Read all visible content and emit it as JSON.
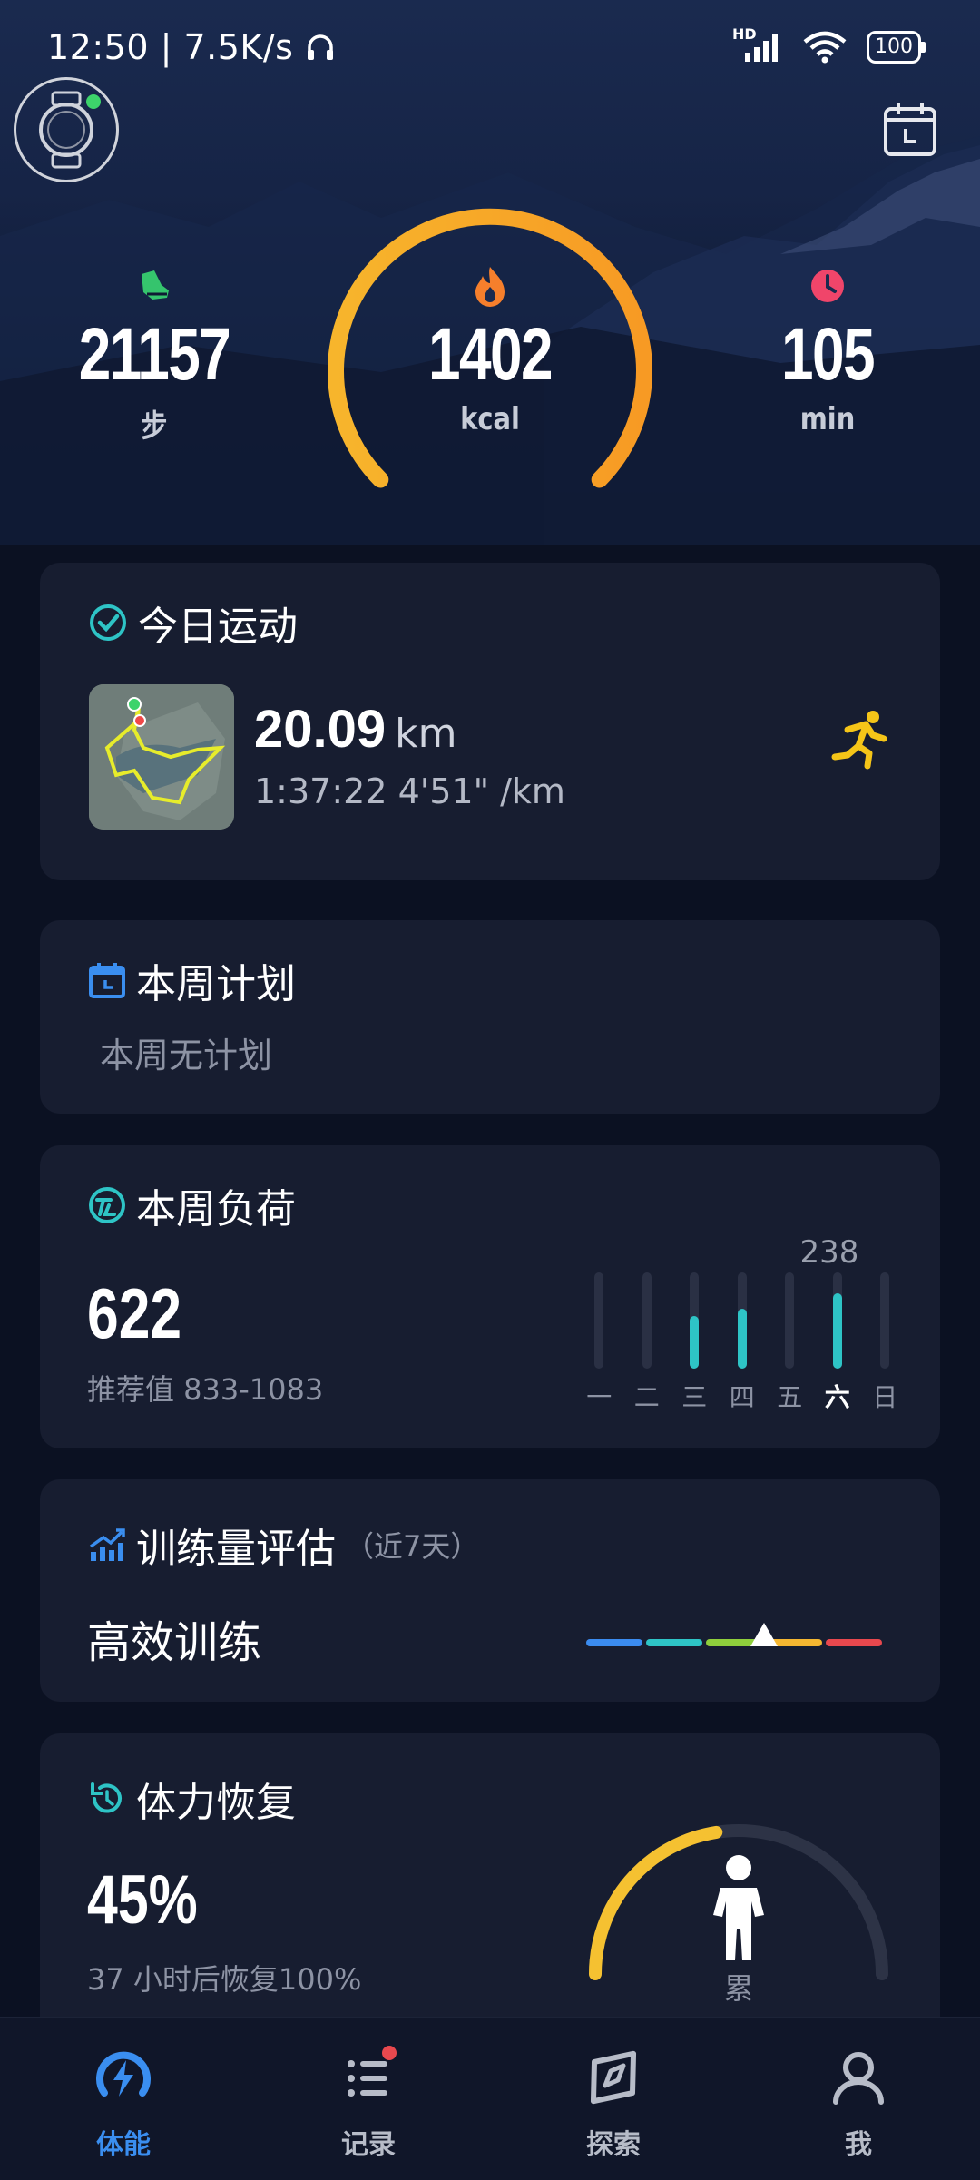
{
  "status_bar": {
    "time": "12:50",
    "speed": "7.5K/s",
    "battery": "100",
    "network": "HD"
  },
  "header": {
    "watch_icon": "watch-icon",
    "calendar_icon": "calendar-icon"
  },
  "summary": {
    "steps": {
      "value": "21157",
      "unit": "步",
      "icon": "footprint-icon"
    },
    "calories": {
      "value": "1402",
      "unit": "kcal",
      "icon": "flame-icon"
    },
    "minutes": {
      "value": "105",
      "unit": "min",
      "icon": "clock-icon"
    }
  },
  "today_workout": {
    "title": "今日运动",
    "distance": "20.09",
    "distance_unit": "km",
    "duration": "1:37:22",
    "pace": "4'51\" /km",
    "activity_icon": "running-icon"
  },
  "weekly_plan": {
    "title": "本周计划",
    "text": "本周无计划"
  },
  "weekly_load": {
    "title": "本周负荷",
    "value": "622",
    "recommend": "推荐值 833-1083",
    "peak_label": "238",
    "days": [
      "一",
      "二",
      "三",
      "四",
      "五",
      "六",
      "日"
    ],
    "levels": [
      0,
      0,
      0.7,
      0.8,
      0,
      1.0,
      0
    ],
    "active_day_index": 5
  },
  "training_eval": {
    "title": "训练量评估",
    "subtitle": "（近7天）",
    "status": "高效训练",
    "scale_colors": [
      "#3b8cf0",
      "#2ec4c6",
      "#8fcf3c",
      "#f5b731",
      "#e8484e"
    ],
    "marker_position": 0.6
  },
  "recovery": {
    "title": "体力恢复",
    "percent": "45%",
    "note": "37 小时后恢复100%",
    "state": "累",
    "level": 0.45
  },
  "tabs": [
    {
      "label": "体能",
      "icon": "energy-icon",
      "active": true
    },
    {
      "label": "记录",
      "icon": "list-icon",
      "active": false,
      "badge": true
    },
    {
      "label": "探索",
      "icon": "compass-icon",
      "active": false
    },
    {
      "label": "我",
      "icon": "profile-icon",
      "active": false
    }
  ],
  "colors": {
    "accent": "#3a8ef0",
    "ring": "#f7a928",
    "load_bar": "#2ec4c6",
    "run": "#f5c518"
  }
}
